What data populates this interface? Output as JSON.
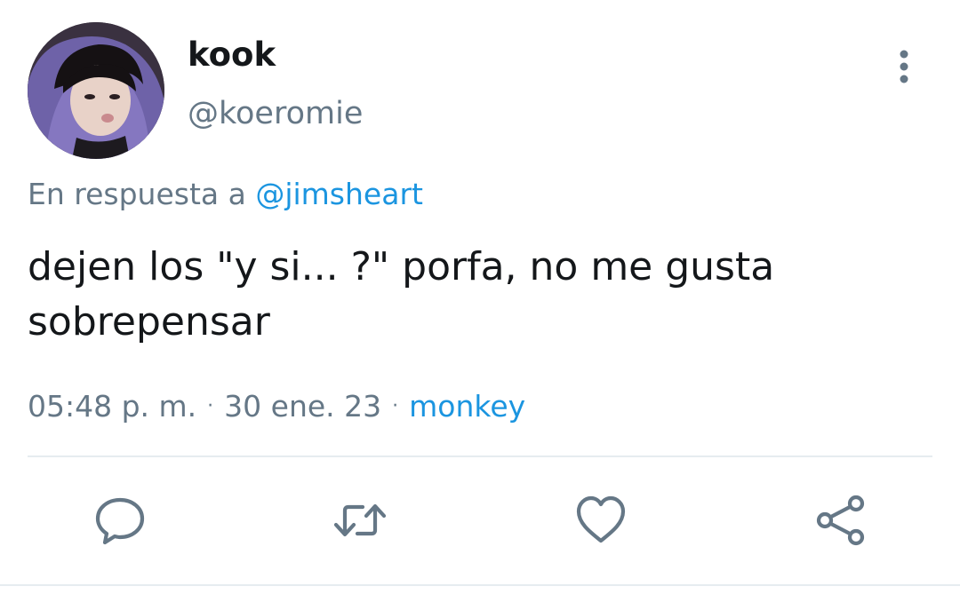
{
  "author": {
    "display_name": "kook",
    "handle": "@koeromie",
    "avatar": "profile-photo"
  },
  "reply_context": {
    "prefix": "En respuesta a ",
    "mention": "@jimsheart"
  },
  "tweet": {
    "text": "dejen los \"y si... ?\" porfa, no me gusta\nsobrepensar"
  },
  "meta": {
    "time": "05:48 p. m.",
    "separator": "·",
    "date": "30 ene. 23",
    "source": "monkey"
  },
  "actions": [
    {
      "name": "reply",
      "icon": "speech-bubble-icon"
    },
    {
      "name": "retweet",
      "icon": "retweet-icon"
    },
    {
      "name": "like",
      "icon": "heart-icon"
    },
    {
      "name": "share",
      "icon": "share-icon"
    }
  ],
  "colors": {
    "text": "#14171a",
    "secondary": "#657786",
    "link": "#1b95e0",
    "icon": "#657786",
    "divider": "#e6ecf0"
  }
}
